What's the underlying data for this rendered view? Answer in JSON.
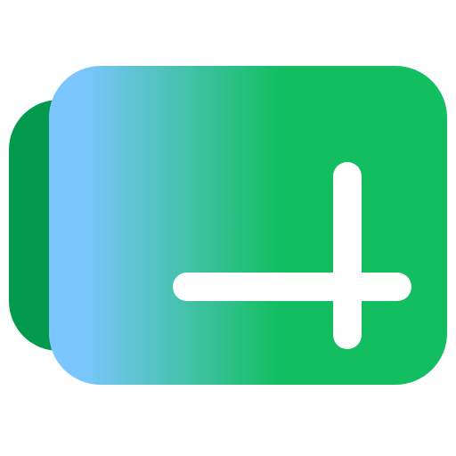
{
  "icon": {
    "name": "add-tab-icon",
    "colors": {
      "back_card": "#049A4D",
      "front_card_main": "#12BE60",
      "gradient_start": "#7CC6FF",
      "plus_stroke": "#FFFFFF"
    }
  }
}
